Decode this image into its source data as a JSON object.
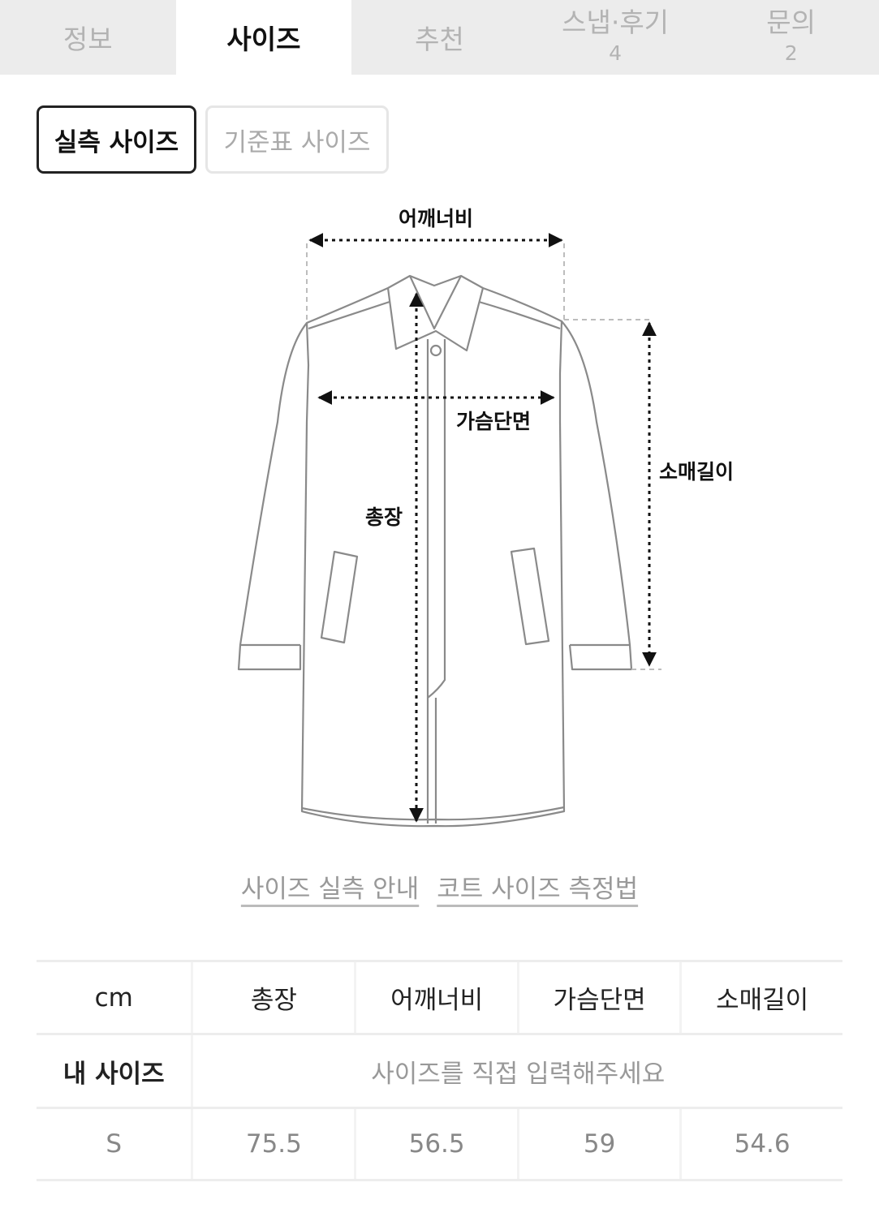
{
  "tabs": [
    {
      "label": "정보",
      "count": null,
      "active": false
    },
    {
      "label": "사이즈",
      "count": null,
      "active": true
    },
    {
      "label": "추천",
      "count": null,
      "active": false
    },
    {
      "label": "스냅·후기",
      "count": "4",
      "active": false
    },
    {
      "label": "문의",
      "count": "2",
      "active": false
    }
  ],
  "size_mode": {
    "actual_label": "실측 사이즈",
    "standard_label": "기준표 사이즈",
    "selected": "actual"
  },
  "diagram": {
    "shoulder_label": "어깨너비",
    "chest_label": "가슴단면",
    "length_label": "총장",
    "sleeve_label": "소매길이"
  },
  "links": {
    "guide_label": "사이즈 실측 안내",
    "method_label": "코트 사이즈 측정법"
  },
  "table": {
    "unit_label": "cm",
    "columns": [
      "총장",
      "어깨너비",
      "가슴단면",
      "소매길이"
    ],
    "my_size_label": "내 사이즈",
    "my_size_placeholder": "사이즈를 직접 입력해주세요",
    "rows": [
      {
        "size": "S",
        "values": [
          "75.5",
          "56.5",
          "59",
          "54.6"
        ]
      }
    ]
  }
}
